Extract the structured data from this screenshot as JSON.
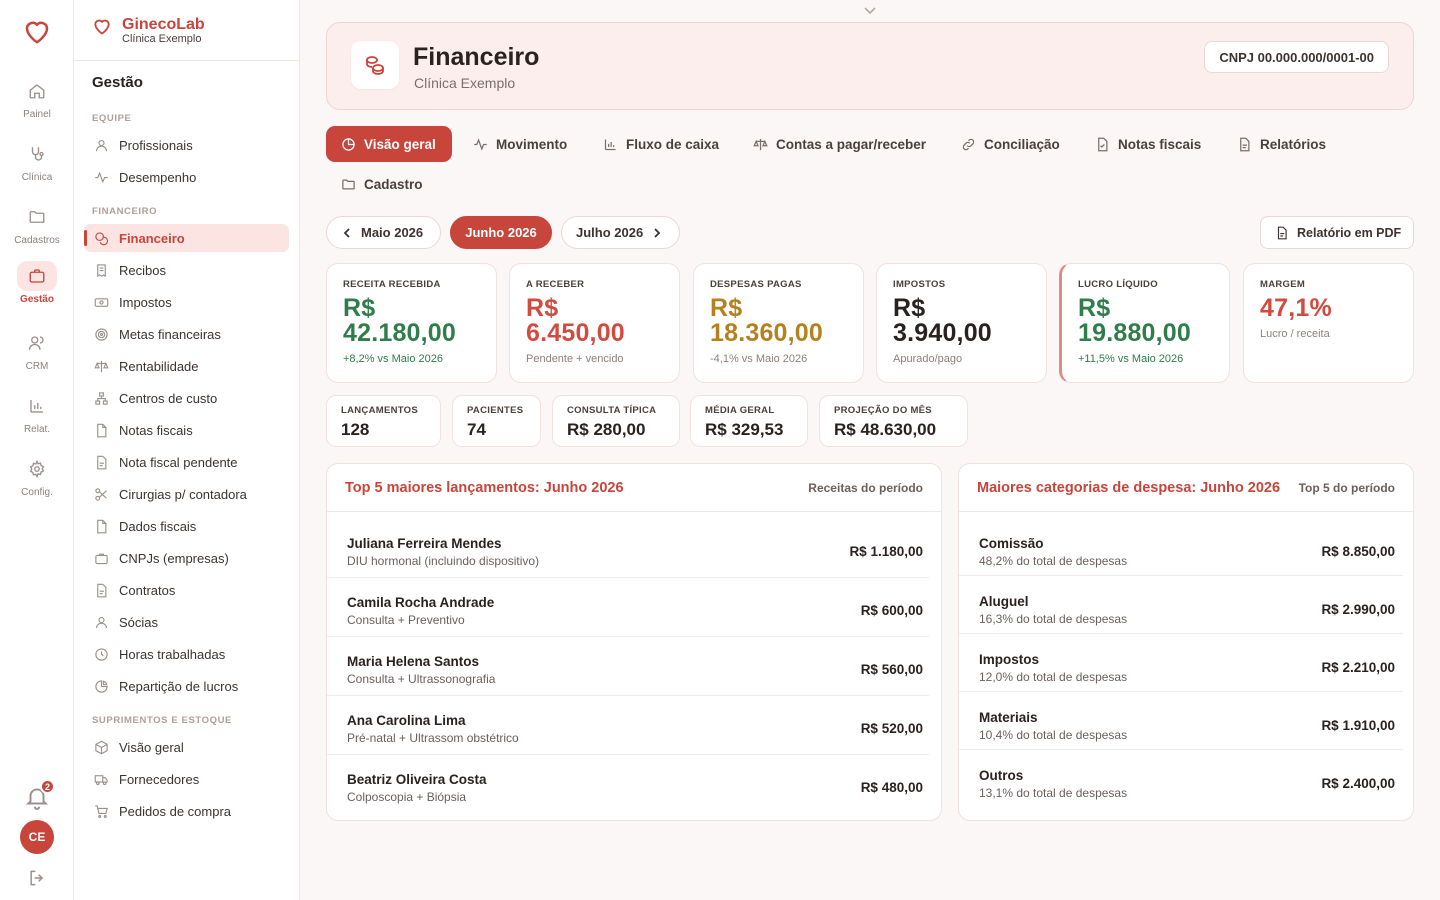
{
  "rail": {
    "items": [
      {
        "label": "Painel",
        "icon": "home-icon"
      },
      {
        "label": "Clínica",
        "icon": "stethoscope-icon"
      },
      {
        "label": "Cadastros",
        "icon": "folder-icon"
      },
      {
        "label": "Gestão",
        "icon": "briefcase-icon",
        "active": true
      },
      {
        "label": "CRM",
        "icon": "users-icon"
      },
      {
        "label": "Relat.",
        "icon": "bar-chart-icon"
      },
      {
        "label": "Config.",
        "icon": "gear-icon"
      }
    ],
    "notifications": "2",
    "avatar": "CE"
  },
  "brand": {
    "name": "GinecoLab",
    "clinic": "Clínica Exemplo"
  },
  "sidebar": {
    "title": "Gestão",
    "sections": {
      "equipe": "EQUIPE",
      "financeiro": "FINANCEIRO",
      "suprimentos": "SUPRIMENTOS E ESTOQUE"
    },
    "equipe": [
      "Profissionais",
      "Desempenho"
    ],
    "financeiro": [
      "Financeiro",
      "Recibos",
      "Impostos",
      "Metas financeiras",
      "Rentabilidade",
      "Centros de custo",
      "Notas fiscais",
      "Nota fiscal pendente",
      "Cirurgias p/ contadora",
      "Dados fiscais",
      "CNPJs (empresas)",
      "Contratos",
      "Sócias",
      "Horas trabalhadas",
      "Repartição de lucros"
    ],
    "suprimentos": [
      "Visão geral",
      "Fornecedores",
      "Pedidos de compra"
    ]
  },
  "header": {
    "title": "Financeiro",
    "subtitle": "Clínica Exemplo",
    "cnpj": "CNPJ 00.000.000/0001-00"
  },
  "tabs": [
    "Visão geral",
    "Movimento",
    "Fluxo de caixa",
    "Contas a pagar/receber",
    "Conciliação",
    "Notas fiscais",
    "Relatórios",
    "Cadastro"
  ],
  "months": {
    "prev": "Maio 2026",
    "current": "Junho 2026",
    "next": "Julho 2026"
  },
  "pdf_button": "Relatório em PDF",
  "kpis": [
    {
      "label": "RECEITA RECEBIDA",
      "currency": "R$",
      "value": "42.180,00",
      "note": "+8,2% vs Maio 2026",
      "color": "#2e7d4a"
    },
    {
      "label": "A RECEBER",
      "currency": "R$",
      "value": "6.450,00",
      "note": "Pendente + vencido",
      "color": "#d14b40"
    },
    {
      "label": "DESPESAS PAGAS",
      "currency": "R$",
      "value": "18.360,00",
      "note": "-4,1% vs Maio 2026",
      "color": "#b5811e"
    },
    {
      "label": "IMPOSTOS",
      "currency": "R$",
      "value": "3.940,00",
      "note": "Apurado/pago",
      "color": "#2a2220"
    },
    {
      "label": "LUCRO LÍQUIDO",
      "currency": "R$",
      "value": "19.880,00",
      "note": "+11,5% vs Maio 2026",
      "color": "#2e7d4a"
    },
    {
      "label": "MARGEM",
      "value": "47,1%",
      "note": "Lucro / receita",
      "color": "#d14b40"
    }
  ],
  "stats": [
    {
      "label": "LANÇAMENTOS",
      "value": "128"
    },
    {
      "label": "PACIENTES",
      "value": "74"
    },
    {
      "label": "CONSULTA TÍPICA",
      "value": "R$ 280,00"
    },
    {
      "label": "MÉDIA GERAL",
      "value": "R$ 329,53"
    },
    {
      "label": "PROJEÇÃO DO MÊS",
      "value": "R$ 48.630,00"
    }
  ],
  "top_lancamentos": {
    "title": "Top 5 maiores lançamentos: Junho 2026",
    "meta": "Receitas do período",
    "rows": [
      {
        "name": "Juliana Ferreira Mendes",
        "desc": "DIU hormonal (incluindo dispositivo)",
        "value": "R$ 1.180,00"
      },
      {
        "name": "Camila Rocha Andrade",
        "desc": "Consulta + Preventivo",
        "value": "R$ 600,00"
      },
      {
        "name": "Maria Helena Santos",
        "desc": "Consulta + Ultrassonografia",
        "value": "R$ 560,00"
      },
      {
        "name": "Ana Carolina Lima",
        "desc": "Pré-natal + Ultrassom obstétrico",
        "value": "R$ 520,00"
      },
      {
        "name": "Beatriz Oliveira Costa",
        "desc": "Colposcopia + Biópsia",
        "value": "R$ 480,00"
      }
    ]
  },
  "despesas": {
    "title": "Maiores categorias de despesa: Junho 2026",
    "meta": "Top 5 do período",
    "rows": [
      {
        "name": "Comissão",
        "desc": "48,2% do total de despesas",
        "value": "R$ 8.850,00"
      },
      {
        "name": "Aluguel",
        "desc": "16,3% do total de despesas",
        "value": "R$ 2.990,00"
      },
      {
        "name": "Impostos",
        "desc": "12,0% do total de despesas",
        "value": "R$ 2.210,00"
      },
      {
        "name": "Materiais",
        "desc": "10,4% do total de despesas",
        "value": "R$ 1.910,00"
      },
      {
        "name": "Outros",
        "desc": "13,1% do total de despesas",
        "value": "R$ 2.400,00"
      }
    ]
  }
}
